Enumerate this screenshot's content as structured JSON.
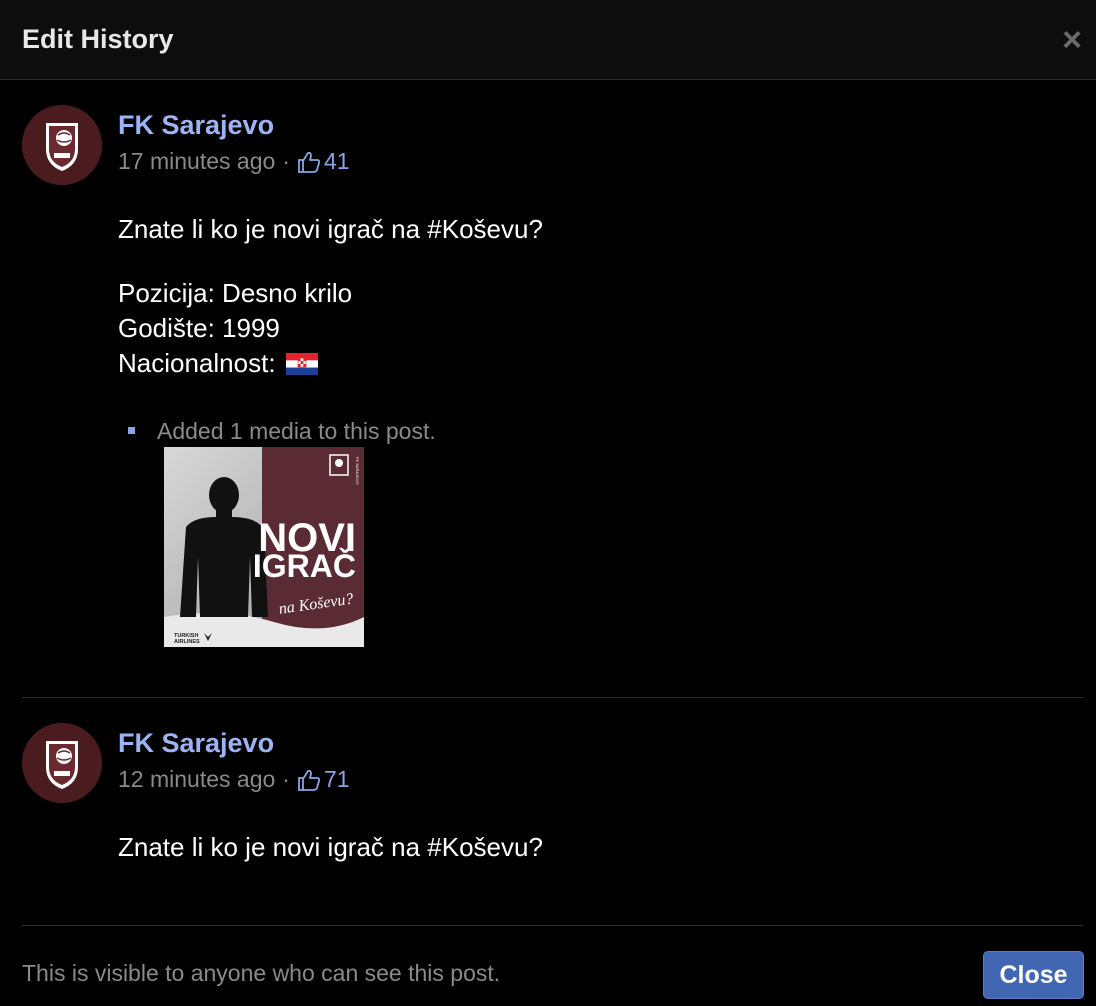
{
  "dialog": {
    "title": "Edit History",
    "close_icon": "close-icon"
  },
  "entries": [
    {
      "author": "FK Sarajevo",
      "time": "17 minutes ago",
      "separator": "·",
      "likes": "41",
      "text_lines": [
        "Znate li ko je novi igrač na #Koševu?",
        "Pozicija: Desno krilo",
        "Godište: 1999",
        "Nacionalnost:"
      ],
      "flag_icon": "croatia-flag-icon",
      "media_note": "Added 1 media to this post.",
      "media": {
        "headline_line1": "NOVI",
        "headline_line2": "IGRAČ",
        "subline": "na Koševu?",
        "sponsor_line1": "TURKISH",
        "sponsor_line2": "AIRLINES"
      }
    },
    {
      "author": "FK Sarajevo",
      "time": "12 minutes ago",
      "separator": "·",
      "likes": "71",
      "text_lines": [
        "Znate li ko je novi igrač na #Koševu?"
      ]
    }
  ],
  "footer": {
    "visibility_text": "This is visible to anyone who can see this post.",
    "close_label": "Close"
  },
  "colors": {
    "link": "#9cb4f5",
    "button": "#4267b2",
    "club_maroon": "#4a1c20"
  }
}
